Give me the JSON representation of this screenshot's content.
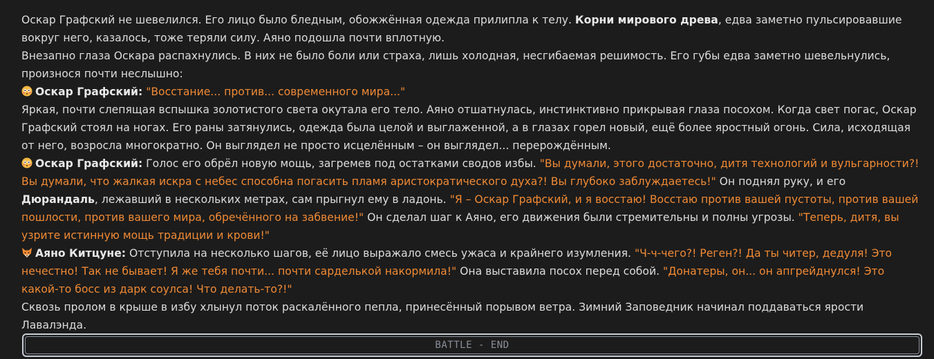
{
  "colors": {
    "background": "#1c1c1c",
    "text": "#dcdcdc",
    "quote": "#f08a35",
    "battle_border": "#c9cdd6"
  },
  "icons": {
    "oskar": "flushed-face-icon",
    "ayano": "fox-face-icon"
  },
  "p1": {
    "t1": "Оскар Графский не шевелился. Его лицо было бледным, обожжённая одежда прилипла к телу. ",
    "b1": "Корни мирового древа",
    "t2": ", едва заметно пульсировавшие вокруг него, казалось, тоже теряли силу. Аяно подошла почти вплотную."
  },
  "p2": {
    "t1": "Внезапно глаза Оскара распахнулись. В них не было боли или страха, лишь холодная, несгибаемая решимость. Его губы едва заметно шевельнулись, произнося почти неслышно:"
  },
  "p3": {
    "speaker": "Оскар Графский:",
    "q1": "\"Восстание... против... современного мира...\""
  },
  "p4": {
    "t1": "Яркая, почти слепящая вспышка золотистого света окутала его тело. Аяно отшатнулась, инстинктивно прикрывая глаза посохом. Когда свет погас, Оскар Графский стоял на ногах. Его раны затянулись, одежда была целой и выглаженной, а в глазах горел новый, ещё более яростный огонь. Сила, исходящая от него, возросла многократно. Он выглядел не просто исцелённым – он выглядел... перерождённым."
  },
  "p5": {
    "speaker": "Оскар Графский:",
    "t1": " Голос его обрёл новую мощь, загремев под остатками сводов избы. ",
    "q1": "\"Вы думали, этого достаточно, дитя технологий и вульгарности?! Вы думали, что жалкая искра с небес способна погасить пламя аристократического духа?! Вы глубоко заблуждаетесь!\"",
    "t2": " Он поднял руку, и его ",
    "b1": "Дюрандаль",
    "t3": ", лежавший в нескольких метрах, сам прыгнул ему в ладонь. ",
    "q2": "\"Я – Оскар Графский, и я восстаю! Восстаю против вашей пустоты, против вашей пошлости, против вашего мира, обречённого на забвение!\"",
    "t4": " Он сделал шаг к Аяно, его движения были стремительны и полны угрозы. ",
    "q3": "\"Теперь, дитя, вы узрите истинную мощь традиции и крови!\""
  },
  "p6": {
    "speaker": "Аяно Китцуне:",
    "t1": " Отступила на несколько шагов, её лицо выражало смесь ужаса и крайнего изумления. ",
    "q1": "\"Ч-ч-чего?! Реген?! Да ты читер, дедуля! Это нечестно! Так не бывает! Я же тебя почти... почти сарделькой накормила!\"",
    "t2": " Она выставила посох перед собой. ",
    "q2": "\"Донатеры, он... он апгрейднулся! Это какой-то босс из дарк соулса! Что делать-то?!\""
  },
  "p7": {
    "t1": "Сквозь пролом в крыше в избу хлынул поток раскалённого пепла, принесённый порывом ветра. Зимний Заповедник начинал поддаваться ярости Лавалэнда."
  },
  "battle": {
    "label": "BATTLE - END"
  }
}
